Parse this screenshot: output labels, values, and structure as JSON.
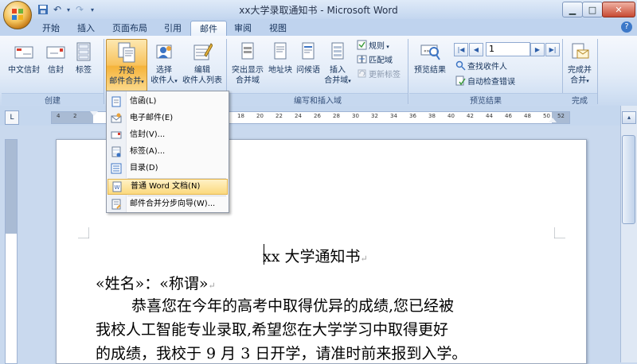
{
  "window": {
    "title": "xx大学录取通知书 - Microsoft Word",
    "minimize": "▁",
    "maximize": "□",
    "close": "✕"
  },
  "tabs": [
    {
      "label": "开始"
    },
    {
      "label": "插入"
    },
    {
      "label": "页面布局"
    },
    {
      "label": "引用"
    },
    {
      "label": "邮件",
      "active": true
    },
    {
      "label": "审阅"
    },
    {
      "label": "视图"
    }
  ],
  "ribbon": {
    "create": {
      "group_label": "创建",
      "chinese_envelope": "中文信封",
      "envelope": "信封",
      "labels": "标签"
    },
    "start_merge": {
      "group_label": "开始邮件合并",
      "start_merge_line1": "开始",
      "start_merge_line2": "邮件合并",
      "select_recipients_line1": "选择",
      "select_recipients_line2": "收件人",
      "edit_list_line1": "编辑",
      "edit_list_line2": "收件人列表"
    },
    "write_insert": {
      "group_label": "编写和插入域",
      "highlight_line1": "突出显示",
      "highlight_line2": "合并域",
      "address_block": "地址块",
      "greeting_line": "问候语",
      "insert_field_line1": "插入",
      "insert_field_line2": "合并域",
      "rules": "规则",
      "match_fields": "匹配域",
      "update_labels": "更新标签"
    },
    "preview": {
      "group_label": "预览结果",
      "preview_results": "预览结果",
      "record_number": "1",
      "find_recipient": "查找收件人",
      "auto_check": "自动检查错误"
    },
    "finish": {
      "group_label": "完成",
      "finish_line1": "完成并",
      "finish_line2": "合并"
    }
  },
  "ruler": {
    "numbers": [
      "4",
      "2",
      "18",
      "20",
      "22",
      "24",
      "26",
      "28",
      "30",
      "32",
      "34",
      "36",
      "38",
      "40",
      "42",
      "44",
      "46",
      "48",
      "50",
      "52"
    ]
  },
  "merge_menu": {
    "items": [
      {
        "label": "信函(L)",
        "icon": "letter-icon"
      },
      {
        "label": "电子邮件(E)",
        "icon": "email-icon"
      },
      {
        "label": "信封(V)...",
        "icon": "envelope-icon"
      },
      {
        "label": "标签(A)...",
        "icon": "label-icon"
      },
      {
        "label": "目录(D)",
        "icon": "directory-icon"
      },
      {
        "label": "普通 Word 文档(N)",
        "icon": "word-doc-icon",
        "highlighted": true
      },
      {
        "label": "邮件合并分步向导(W)...",
        "icon": "wizard-icon"
      }
    ]
  },
  "document": {
    "heading": "xx 大学通知书",
    "line1": "«姓名»：«称谓»",
    "line2": "恭喜您在今年的高考中取得优异的成绩,您已经被",
    "line3": "我校人工智能专业录取,希望您在大学学习中取得更好",
    "line4": "的成绩，我校于 9 月 3 日开学，请准时前来报到入学。"
  }
}
